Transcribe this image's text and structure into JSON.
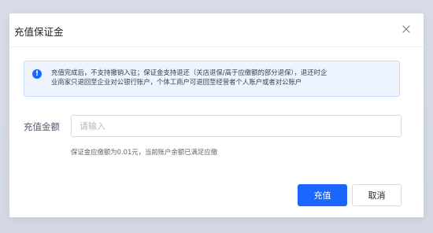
{
  "dialog": {
    "title": "充值保证金",
    "close_icon": "close-icon"
  },
  "notice": {
    "icon": "info-circle-icon",
    "icon_glyph": "!",
    "line1": "充值完成后，不支持撤销入驻；保证金支持退还（关店退保/高于应缴额的部分退保），退还时企",
    "line2": "业商家只退回至企业对公银行账户，个体工商户可退回至经营者个人账户或者对公账户"
  },
  "form": {
    "amount_label": "充值金额",
    "amount_value": "",
    "amount_placeholder": "请输入",
    "hint": "保证金应缴额为0.01元，当前账户余额已满足应缴"
  },
  "buttons": {
    "confirm_label": "充值",
    "cancel_label": "取消"
  },
  "colors": {
    "primary": "#1a66ff",
    "notice_bg": "#eef4ff"
  }
}
